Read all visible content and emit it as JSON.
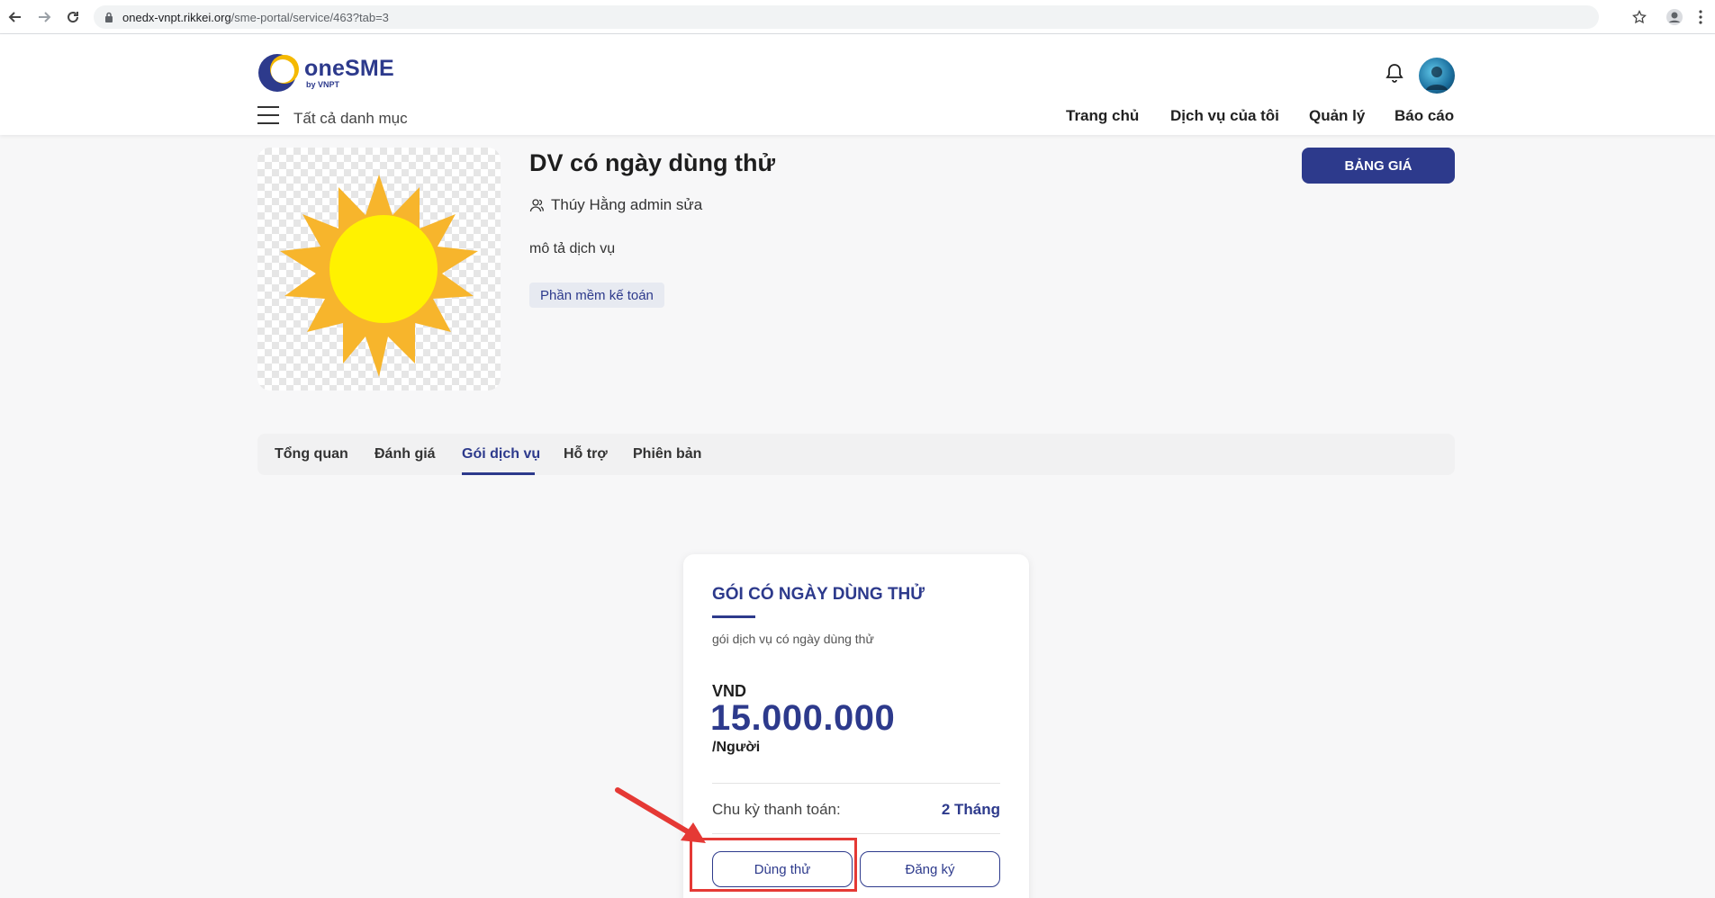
{
  "browser": {
    "url_host": "onedx-vnpt.rikkei.org",
    "url_path": "/sme-portal/service/463?tab=3"
  },
  "header": {
    "logo_brand": "oneSME",
    "logo_by": "by VNPT",
    "all_categories": "Tất cả danh mục",
    "nav": [
      "Trang chủ",
      "Dịch vụ của tôi",
      "Quản lý",
      "Báo cáo"
    ]
  },
  "service": {
    "title": "DV có ngày dùng thử",
    "author": "Thúy Hằng admin sửa",
    "description": "mô tả dịch vụ",
    "tag": "Phần mềm kế toán",
    "price_button": "BẢNG GIÁ"
  },
  "tabs": [
    {
      "label": "Tổng quan",
      "active": false
    },
    {
      "label": "Đánh giá",
      "active": false
    },
    {
      "label": "Gói dịch vụ",
      "active": true
    },
    {
      "label": "Hỗ trợ",
      "active": false
    },
    {
      "label": "Phiên bản",
      "active": false
    }
  ],
  "plan": {
    "name": "GÓI CÓ NGÀY DÙNG THỬ",
    "description": "gói dịch vụ có ngày dùng thử",
    "currency": "VND",
    "amount": "15.000.000",
    "unit": "/Người",
    "cycle_label": "Chu kỳ thanh toán:",
    "cycle_value": "2 Tháng",
    "trial_button": "Dùng thử",
    "register_button": "Đăng ký"
  },
  "colors": {
    "primary": "#2d3a8c",
    "annotation": "#e53935",
    "sun_core": "#fff200",
    "sun_rays": "#f7b52c"
  }
}
